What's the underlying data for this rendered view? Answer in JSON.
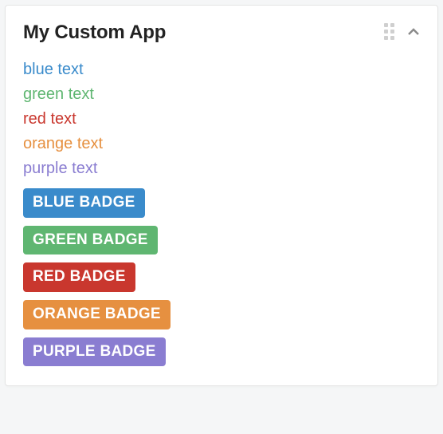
{
  "title": "My Custom App",
  "colors": {
    "blue": "#3A8BCB",
    "green": "#5FB671",
    "red": "#C9372E",
    "orange": "#E69040",
    "purple": "#8A7DD1"
  },
  "texts": [
    {
      "label": "blue text",
      "color": "blue"
    },
    {
      "label": "green text",
      "color": "green"
    },
    {
      "label": "red text",
      "color": "red"
    },
    {
      "label": "orange text",
      "color": "orange"
    },
    {
      "label": "purple text",
      "color": "purple"
    }
  ],
  "badges": [
    {
      "label": "BLUE BADGE",
      "color": "blue"
    },
    {
      "label": "GREEN BADGE",
      "color": "green"
    },
    {
      "label": "RED BADGE",
      "color": "red"
    },
    {
      "label": "ORANGE BADGE",
      "color": "orange"
    },
    {
      "label": "PURPLE BADGE",
      "color": "purple"
    }
  ]
}
